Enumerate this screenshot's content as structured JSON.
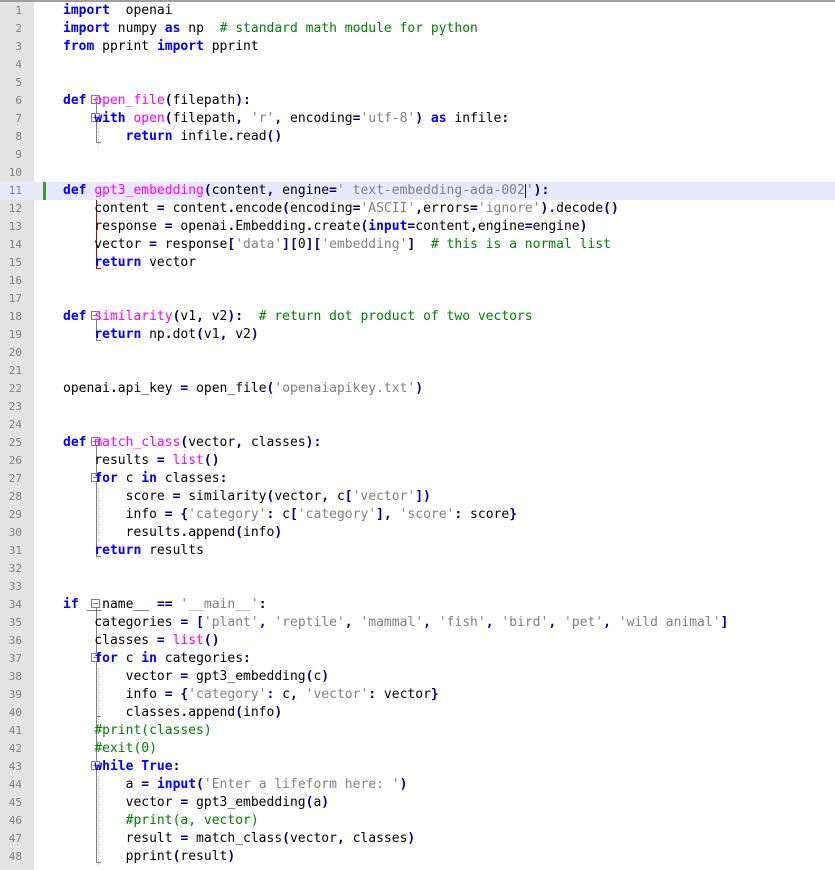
{
  "editor": {
    "current_line": 11,
    "lines": [
      [
        [
          "kw",
          "import"
        ],
        [
          "",
          "  openai"
        ]
      ],
      [
        [
          "kw",
          "import"
        ],
        [
          "",
          " numpy "
        ],
        [
          "kw",
          "as"
        ],
        [
          "",
          " np  "
        ],
        [
          "com",
          "# standard math module for python"
        ]
      ],
      [
        [
          "kw",
          "from"
        ],
        [
          "",
          " pprint "
        ],
        [
          "kw",
          "import"
        ],
        [
          "",
          " pprint"
        ]
      ],
      [],
      [],
      [
        [
          "kw",
          "def"
        ],
        [
          "",
          " "
        ],
        [
          "fn",
          "open_file"
        ],
        [
          "op",
          "("
        ],
        [
          "",
          "filepath"
        ],
        [
          "op",
          ")"
        ],
        [
          "op",
          ":"
        ]
      ],
      [
        [
          "",
          "    "
        ],
        [
          "kw",
          "with"
        ],
        [
          "",
          " "
        ],
        [
          "fn",
          "open"
        ],
        [
          "op",
          "("
        ],
        [
          "",
          "filepath"
        ],
        [
          "op",
          ","
        ],
        [
          "",
          " "
        ],
        [
          "str",
          "'r'"
        ],
        [
          "op",
          ","
        ],
        [
          "",
          " encoding"
        ],
        [
          "op",
          "="
        ],
        [
          "str",
          "'utf-8'"
        ],
        [
          "op",
          ")"
        ],
        [
          "",
          " "
        ],
        [
          "kw",
          "as"
        ],
        [
          "",
          " infile"
        ],
        [
          "op",
          ":"
        ]
      ],
      [
        [
          "",
          "        "
        ],
        [
          "kw",
          "return"
        ],
        [
          "",
          " infile"
        ],
        [
          "op",
          "."
        ],
        [
          "",
          "read"
        ],
        [
          "op",
          "()"
        ]
      ],
      [],
      [],
      [
        [
          "kw",
          "def"
        ],
        [
          "",
          " "
        ],
        [
          "fn",
          "gpt3_embedding"
        ],
        [
          "op",
          "("
        ],
        [
          "",
          "content"
        ],
        [
          "op",
          ","
        ],
        [
          "",
          " engine"
        ],
        [
          "op",
          "="
        ],
        [
          "str",
          "' text-embedding-ada-002"
        ],
        [
          "caret",
          ""
        ],
        [
          "str",
          "'"
        ],
        [
          "op",
          ")"
        ],
        [
          "op",
          ":"
        ]
      ],
      [
        [
          "",
          "    content "
        ],
        [
          "op",
          "="
        ],
        [
          "",
          " content"
        ],
        [
          "op",
          "."
        ],
        [
          "",
          "encode"
        ],
        [
          "op",
          "("
        ],
        [
          "",
          "encoding"
        ],
        [
          "op",
          "="
        ],
        [
          "str",
          "'ASCII'"
        ],
        [
          "op",
          ","
        ],
        [
          "",
          "errors"
        ],
        [
          "op",
          "="
        ],
        [
          "str",
          "'ignore'"
        ],
        [
          "op",
          ")."
        ],
        [
          "",
          "decode"
        ],
        [
          "op",
          "()"
        ]
      ],
      [
        [
          "",
          "    response "
        ],
        [
          "op",
          "="
        ],
        [
          "",
          " openai"
        ],
        [
          "op",
          "."
        ],
        [
          "",
          "Embedding"
        ],
        [
          "op",
          "."
        ],
        [
          "",
          "create"
        ],
        [
          "op",
          "("
        ],
        [
          "kw",
          "input"
        ],
        [
          "op",
          "="
        ],
        [
          "",
          "content"
        ],
        [
          "op",
          ","
        ],
        [
          "",
          "engine"
        ],
        [
          "op",
          "="
        ],
        [
          "",
          "engine"
        ],
        [
          "op",
          ")"
        ]
      ],
      [
        [
          "",
          "    vector "
        ],
        [
          "op",
          "="
        ],
        [
          "",
          " response"
        ],
        [
          "op",
          "["
        ],
        [
          "str",
          "'data'"
        ],
        [
          "op",
          "]["
        ],
        [
          "",
          "0"
        ],
        [
          "op",
          "]["
        ],
        [
          "str",
          "'embedding'"
        ],
        [
          "op",
          "]"
        ],
        [
          "",
          "  "
        ],
        [
          "com",
          "# this is a normal list"
        ]
      ],
      [
        [
          "",
          "    "
        ],
        [
          "kw",
          "return"
        ],
        [
          "",
          " vector"
        ]
      ],
      [],
      [],
      [
        [
          "kw",
          "def"
        ],
        [
          "",
          " "
        ],
        [
          "fn",
          "similarity"
        ],
        [
          "op",
          "("
        ],
        [
          "",
          "v1"
        ],
        [
          "op",
          ","
        ],
        [
          "",
          " v2"
        ],
        [
          "op",
          "):"
        ],
        [
          "",
          "  "
        ],
        [
          "com",
          "# return dot product of two vectors"
        ]
      ],
      [
        [
          "",
          "    "
        ],
        [
          "kw",
          "return"
        ],
        [
          "",
          " np"
        ],
        [
          "op",
          "."
        ],
        [
          "",
          "dot"
        ],
        [
          "op",
          "("
        ],
        [
          "",
          "v1"
        ],
        [
          "op",
          ","
        ],
        [
          "",
          " v2"
        ],
        [
          "op",
          ")"
        ]
      ],
      [],
      [],
      [
        [
          "",
          "openai"
        ],
        [
          "op",
          "."
        ],
        [
          "",
          "api_key "
        ],
        [
          "op",
          "="
        ],
        [
          "",
          " open_file"
        ],
        [
          "op",
          "("
        ],
        [
          "str",
          "'openaiapikey.txt'"
        ],
        [
          "op",
          ")"
        ]
      ],
      [],
      [],
      [
        [
          "kw",
          "def"
        ],
        [
          "",
          " "
        ],
        [
          "fn",
          "match_class"
        ],
        [
          "op",
          "("
        ],
        [
          "",
          "vector"
        ],
        [
          "op",
          ","
        ],
        [
          "",
          " classes"
        ],
        [
          "op",
          "):"
        ]
      ],
      [
        [
          "",
          "    results "
        ],
        [
          "op",
          "="
        ],
        [
          "",
          " "
        ],
        [
          "fn",
          "list"
        ],
        [
          "op",
          "()"
        ]
      ],
      [
        [
          "",
          "    "
        ],
        [
          "kw",
          "for"
        ],
        [
          "",
          " c "
        ],
        [
          "kw",
          "in"
        ],
        [
          "",
          " classes"
        ],
        [
          "op",
          ":"
        ]
      ],
      [
        [
          "",
          "        score "
        ],
        [
          "op",
          "="
        ],
        [
          "",
          " similarity"
        ],
        [
          "op",
          "("
        ],
        [
          "",
          "vector"
        ],
        [
          "op",
          ","
        ],
        [
          "",
          " c"
        ],
        [
          "op",
          "["
        ],
        [
          "str",
          "'vector'"
        ],
        [
          "op",
          "])"
        ]
      ],
      [
        [
          "",
          "        info "
        ],
        [
          "op",
          "="
        ],
        [
          "",
          " "
        ],
        [
          "op",
          "{"
        ],
        [
          "str",
          "'category'"
        ],
        [
          "op",
          ":"
        ],
        [
          "",
          " c"
        ],
        [
          "op",
          "["
        ],
        [
          "str",
          "'category'"
        ],
        [
          "op",
          "],"
        ],
        [
          "",
          " "
        ],
        [
          "str",
          "'score'"
        ],
        [
          "op",
          ":"
        ],
        [
          "",
          " score"
        ],
        [
          "op",
          "}"
        ]
      ],
      [
        [
          "",
          "        results"
        ],
        [
          "op",
          "."
        ],
        [
          "",
          "append"
        ],
        [
          "op",
          "("
        ],
        [
          "",
          "info"
        ],
        [
          "op",
          ")"
        ]
      ],
      [
        [
          "",
          "    "
        ],
        [
          "kw",
          "return"
        ],
        [
          "",
          " results"
        ]
      ],
      [],
      [],
      [
        [
          "kw",
          "if"
        ],
        [
          "",
          " __name__ "
        ],
        [
          "op",
          "=="
        ],
        [
          "",
          " "
        ],
        [
          "str",
          "'__main__'"
        ],
        [
          "op",
          ":"
        ]
      ],
      [
        [
          "",
          "    categories "
        ],
        [
          "op",
          "="
        ],
        [
          "",
          " "
        ],
        [
          "op",
          "["
        ],
        [
          "str",
          "'plant'"
        ],
        [
          "op",
          ","
        ],
        [
          "",
          " "
        ],
        [
          "str",
          "'reptile'"
        ],
        [
          "op",
          ","
        ],
        [
          "",
          " "
        ],
        [
          "str",
          "'mammal'"
        ],
        [
          "op",
          ","
        ],
        [
          "",
          " "
        ],
        [
          "str",
          "'fish'"
        ],
        [
          "op",
          ","
        ],
        [
          "",
          " "
        ],
        [
          "str",
          "'bird'"
        ],
        [
          "op",
          ","
        ],
        [
          "",
          " "
        ],
        [
          "str",
          "'pet'"
        ],
        [
          "op",
          ","
        ],
        [
          "",
          " "
        ],
        [
          "str",
          "'wild animal'"
        ],
        [
          "op",
          "]"
        ]
      ],
      [
        [
          "",
          "    classes "
        ],
        [
          "op",
          "="
        ],
        [
          "",
          " "
        ],
        [
          "fn",
          "list"
        ],
        [
          "op",
          "()"
        ]
      ],
      [
        [
          "",
          "    "
        ],
        [
          "kw",
          "for"
        ],
        [
          "",
          " c "
        ],
        [
          "kw",
          "in"
        ],
        [
          "",
          " categories"
        ],
        [
          "op",
          ":"
        ]
      ],
      [
        [
          "",
          "        vector "
        ],
        [
          "op",
          "="
        ],
        [
          "",
          " gpt3_embedding"
        ],
        [
          "op",
          "("
        ],
        [
          "",
          "c"
        ],
        [
          "op",
          ")"
        ]
      ],
      [
        [
          "",
          "        info "
        ],
        [
          "op",
          "="
        ],
        [
          "",
          " "
        ],
        [
          "op",
          "{"
        ],
        [
          "str",
          "'category'"
        ],
        [
          "op",
          ":"
        ],
        [
          "",
          " c"
        ],
        [
          "op",
          ","
        ],
        [
          "",
          " "
        ],
        [
          "str",
          "'vector'"
        ],
        [
          "op",
          ":"
        ],
        [
          "",
          " vector"
        ],
        [
          "op",
          "}"
        ]
      ],
      [
        [
          "",
          "        classes"
        ],
        [
          "op",
          "."
        ],
        [
          "",
          "append"
        ],
        [
          "op",
          "("
        ],
        [
          "",
          "info"
        ],
        [
          "op",
          ")"
        ]
      ],
      [
        [
          "",
          "    "
        ],
        [
          "com",
          "#print(classes)"
        ]
      ],
      [
        [
          "",
          "    "
        ],
        [
          "com",
          "#exit(0)"
        ]
      ],
      [
        [
          "",
          "    "
        ],
        [
          "kw",
          "while"
        ],
        [
          "",
          " "
        ],
        [
          "kw",
          "True"
        ],
        [
          "op",
          ":"
        ]
      ],
      [
        [
          "",
          "        a "
        ],
        [
          "op",
          "="
        ],
        [
          "",
          " "
        ],
        [
          "kw",
          "input"
        ],
        [
          "op",
          "("
        ],
        [
          "str",
          "'Enter a lifeform here: '"
        ],
        [
          "op",
          ")"
        ]
      ],
      [
        [
          "",
          "        vector "
        ],
        [
          "op",
          "="
        ],
        [
          "",
          " gpt3_embedding"
        ],
        [
          "op",
          "("
        ],
        [
          "",
          "a"
        ],
        [
          "op",
          ")"
        ]
      ],
      [
        [
          "",
          "        "
        ],
        [
          "com",
          "#print(a, vector)"
        ]
      ],
      [
        [
          "",
          "        result "
        ],
        [
          "op",
          "="
        ],
        [
          "",
          " match_class"
        ],
        [
          "op",
          "("
        ],
        [
          "",
          "vector"
        ],
        [
          "op",
          ","
        ],
        [
          "",
          " classes"
        ],
        [
          "op",
          ")"
        ]
      ],
      [
        [
          "",
          "        pprint"
        ],
        [
          "op",
          "("
        ],
        [
          "",
          "result"
        ],
        [
          "op",
          ")"
        ]
      ]
    ]
  }
}
